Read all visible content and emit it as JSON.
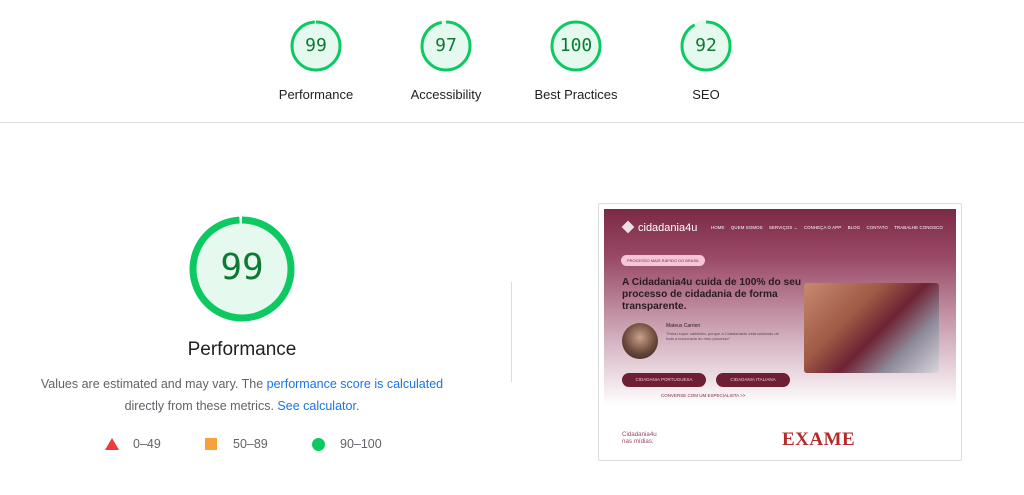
{
  "summary": {
    "gauges": [
      {
        "label": "Performance",
        "score": "99",
        "value": 99
      },
      {
        "label": "Accessibility",
        "score": "97",
        "value": 97
      },
      {
        "label": "Best Practices",
        "score": "100",
        "value": 100
      },
      {
        "label": "SEO",
        "score": "92",
        "value": 92
      }
    ]
  },
  "main": {
    "score": "99",
    "value": 99,
    "title": "Performance",
    "desc_part1": "Values are estimated and may vary. The ",
    "desc_link1": "performance score is calculated",
    "desc_part2": " directly from these metrics. ",
    "desc_link2": "See calculator",
    "desc_part3": "."
  },
  "legend": [
    {
      "icon": "triangle-icon",
      "range": "0–49",
      "color": "#eb3b3b"
    },
    {
      "icon": "square-icon",
      "range": "50–89",
      "color": "#f6a23a"
    },
    {
      "icon": "circle-icon",
      "range": "90–100",
      "color": "#0cc961"
    }
  ],
  "colors": {
    "pass": "#0cc961",
    "pass_text": "#0b7a32",
    "pass_fill": "#e6f9ee",
    "link": "#1a73e8"
  },
  "thumbnail": {
    "logo": "cidadania4u",
    "nav": [
      "HOME",
      "QUEM SOMOS",
      "SERVIÇOS ⌄",
      "CONHEÇA O APP",
      "BLOG",
      "CONTATO",
      "TRABALHE CONOSCO"
    ],
    "pill": "PROCESSO MAIS RÁPIDO DO BRASIL",
    "headline": "A Cidadania4u cuida de 100% do seu processo de cidadania de forma transparente.",
    "person_name": "Mateus Carrieri",
    "quote": "\"Estou super satisfeito, porque a Cidadania4u está cuidando de toda a burocracia do meu processo\"",
    "btn1": "CIDADANIA PORTUGUESA",
    "btn2": "CIDADANIA ITALIANA",
    "link": "CONVERSE COM UM ESPECIALISTA >>",
    "media_line1": "Cidadania4u",
    "media_line2": "nas mídias:",
    "media_logo": "EXAME"
  }
}
